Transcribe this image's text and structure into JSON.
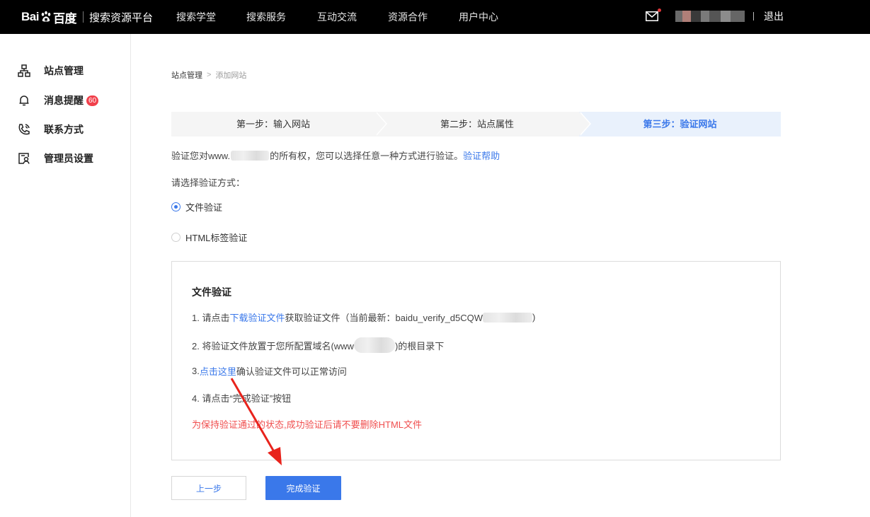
{
  "header": {
    "logo_bai": "Bai",
    "logo_du": "百度",
    "platform_name": "搜索资源平台",
    "nav": [
      "搜索学堂",
      "搜索服务",
      "互动交流",
      "资源合作",
      "用户中心"
    ],
    "logout": "退出",
    "mail_icon": "mail-icon"
  },
  "sidebar": {
    "items": [
      {
        "label": "站点管理",
        "icon": "sitemap-icon"
      },
      {
        "label": "消息提醒",
        "icon": "bell-icon",
        "badge": "60"
      },
      {
        "label": "联系方式",
        "icon": "phone-icon"
      },
      {
        "label": "管理员设置",
        "icon": "admin-icon"
      }
    ]
  },
  "breadcrumb": {
    "parent": "站点管理",
    "separator": ">",
    "current": "添加网站"
  },
  "steps": [
    {
      "label": "第一步：输入网站"
    },
    {
      "label": "第二步：站点属性"
    },
    {
      "label": "第三步：验证网站",
      "active": true
    }
  ],
  "intro": {
    "prefix": "验证您对www.",
    "suffix": "的所有权，您可以选择任意一种方式进行验证。",
    "help_link": "验证帮助"
  },
  "choose_label": "请选择验证方式：",
  "options": [
    {
      "label": "文件验证",
      "checked": true
    },
    {
      "label": "HTML标签验证",
      "checked": false
    }
  ],
  "file_verify": {
    "title": "文件验证",
    "step1_prefix": "1.  请点击",
    "step1_link": "下载验证文件",
    "step1_suffix": "获取验证文件（当前最新：baidu_verify_d5CQW",
    "step1_end": ")",
    "step2_prefix": "2.  将验证文件放置于您所配置域名(www",
    "step2_suffix": ")的根目录下",
    "step3_prefix": "3.  ",
    "step3_link": "点击这里",
    "step3_suffix": "确认验证文件可以正常访问",
    "step4": "4.  请点击“完成验证”按钮",
    "warning": "为保持验证通过的状态,成功验证后请不要删除HTML文件"
  },
  "buttons": {
    "prev": "上一步",
    "done": "完成验证"
  },
  "colors": {
    "accent": "#3a78ea",
    "warning": "#f04f4f",
    "badge": "#f1404b",
    "active_step_bg": "#e9f1fc",
    "annotation_arrow": "#e8231c"
  }
}
